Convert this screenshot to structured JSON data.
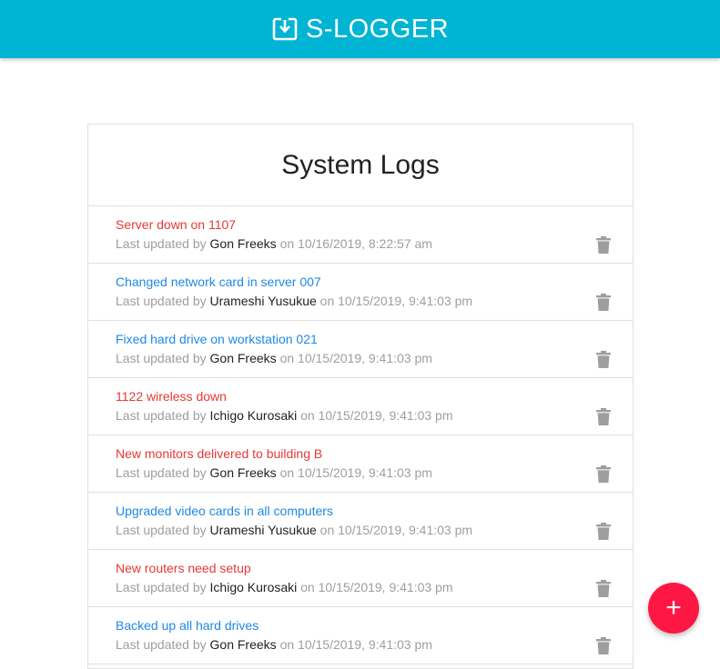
{
  "navbar": {
    "brand": "S-LOGGER",
    "brand_icon": "system-update-icon",
    "color": "#00b4d3"
  },
  "card": {
    "title": "System Logs"
  },
  "labels": {
    "last_updated_by": "Last updated by",
    "on": "on"
  },
  "colors": {
    "attention": "#e53935",
    "normal": "#1e88e5"
  },
  "logs": [
    {
      "message": "Server down on 1107",
      "attention": true,
      "tech": "Gon Freeks",
      "date": "10/16/2019, 8:22:57 am"
    },
    {
      "message": "Changed network card in server 007",
      "attention": false,
      "tech": "Urameshi Yusukue",
      "date": "10/15/2019, 9:41:03 pm"
    },
    {
      "message": "Fixed hard drive on workstation 021",
      "attention": false,
      "tech": "Gon Freeks",
      "date": "10/15/2019, 9:41:03 pm"
    },
    {
      "message": "1122 wireless down",
      "attention": true,
      "tech": "Ichigo Kurosaki",
      "date": "10/15/2019, 9:41:03 pm"
    },
    {
      "message": "New monitors delivered to building B",
      "attention": true,
      "tech": "Gon Freeks",
      "date": "10/15/2019, 9:41:03 pm"
    },
    {
      "message": "Upgraded video cards in all computers",
      "attention": false,
      "tech": "Urameshi Yusukue",
      "date": "10/15/2019, 9:41:03 pm"
    },
    {
      "message": "New routers need setup",
      "attention": true,
      "tech": "Ichigo Kurosaki",
      "date": "10/15/2019, 9:41:03 pm"
    },
    {
      "message": "Backed up all hard drives",
      "attention": false,
      "tech": "Gon Freeks",
      "date": "10/15/2019, 9:41:03 pm"
    }
  ],
  "fab": {
    "label": "+",
    "icon": "add-icon",
    "color": "#ff1744"
  }
}
